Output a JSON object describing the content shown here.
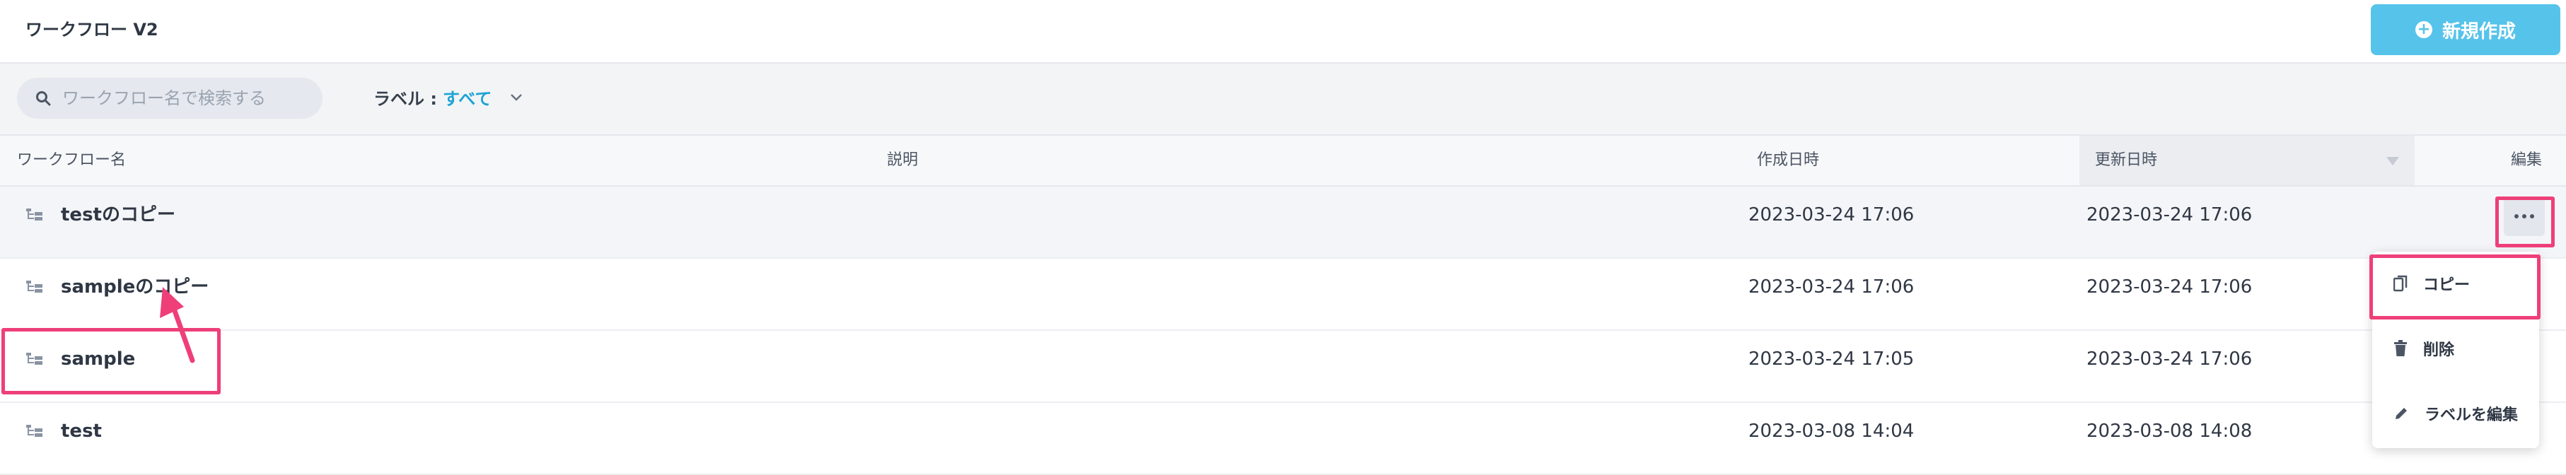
{
  "header": {
    "title": "ワークフロー V2",
    "new_button": "新規作成"
  },
  "filter": {
    "search_placeholder": "ワークフロー名で検索する",
    "label_prefix": "ラベル :",
    "label_value": "すべて"
  },
  "table": {
    "columns": {
      "name": "ワークフロー名",
      "description": "説明",
      "created": "作成日時",
      "updated": "更新日時",
      "edit": "編集"
    },
    "rows": [
      {
        "name": "testのコピー",
        "created": "2023-03-24 17:06",
        "updated": "2023-03-24 17:06"
      },
      {
        "name": "sampleのコピー",
        "created": "2023-03-24 17:06",
        "updated": "2023-03-24 17:06"
      },
      {
        "name": "sample",
        "created": "2023-03-24 17:05",
        "updated": "2023-03-24 17:06"
      },
      {
        "name": "test",
        "created": "2023-03-08 14:04",
        "updated": "2023-03-08 14:08"
      }
    ]
  },
  "menu": {
    "copy": "コピー",
    "delete": "削除",
    "edit_label": "ラベルを編集"
  },
  "colors": {
    "accent": "#56c3ea",
    "link": "#1ea3d6",
    "highlight": "#ee3f79"
  }
}
